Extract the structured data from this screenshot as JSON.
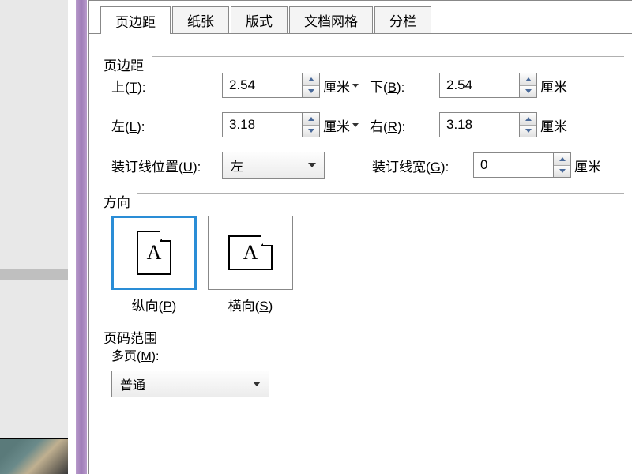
{
  "tabs": {
    "margins": "页边距",
    "paper": "纸张",
    "layout": "版式",
    "grid": "文档网格",
    "columns": "分栏"
  },
  "sections": {
    "margins": "页边距",
    "orientation": "方向",
    "pagerange": "页码范围"
  },
  "margins": {
    "top_label_a": "上(",
    "top_label_u": "T",
    "top_label_b": "):",
    "top_value": "2.54",
    "bottom_label_a": "下(",
    "bottom_label_u": "B",
    "bottom_label_b": "):",
    "bottom_value": "2.54",
    "left_label_a": "左(",
    "left_label_u": "L",
    "left_label_b": "):",
    "left_value": "3.18",
    "right_label_a": "右(",
    "right_label_u": "R",
    "right_label_b": "):",
    "right_value": "3.18",
    "gutter_pos_a": "装订线位置(",
    "gutter_pos_u": "U",
    "gutter_pos_b": "):",
    "gutter_pos_value": "左",
    "gutter_w_a": "装订线宽(",
    "gutter_w_u": "G",
    "gutter_w_b": "):",
    "gutter_w_value": "0",
    "unit": "厘米"
  },
  "orientation": {
    "portrait_a": "纵向(",
    "portrait_u": "P",
    "portrait_b": ")",
    "landscape_a": "横向(",
    "landscape_u": "S",
    "landscape_b": ")",
    "glyph": "A"
  },
  "pagerange": {
    "multi_a": "多页(",
    "multi_u": "M",
    "multi_b": "):",
    "multi_value": "普通"
  }
}
